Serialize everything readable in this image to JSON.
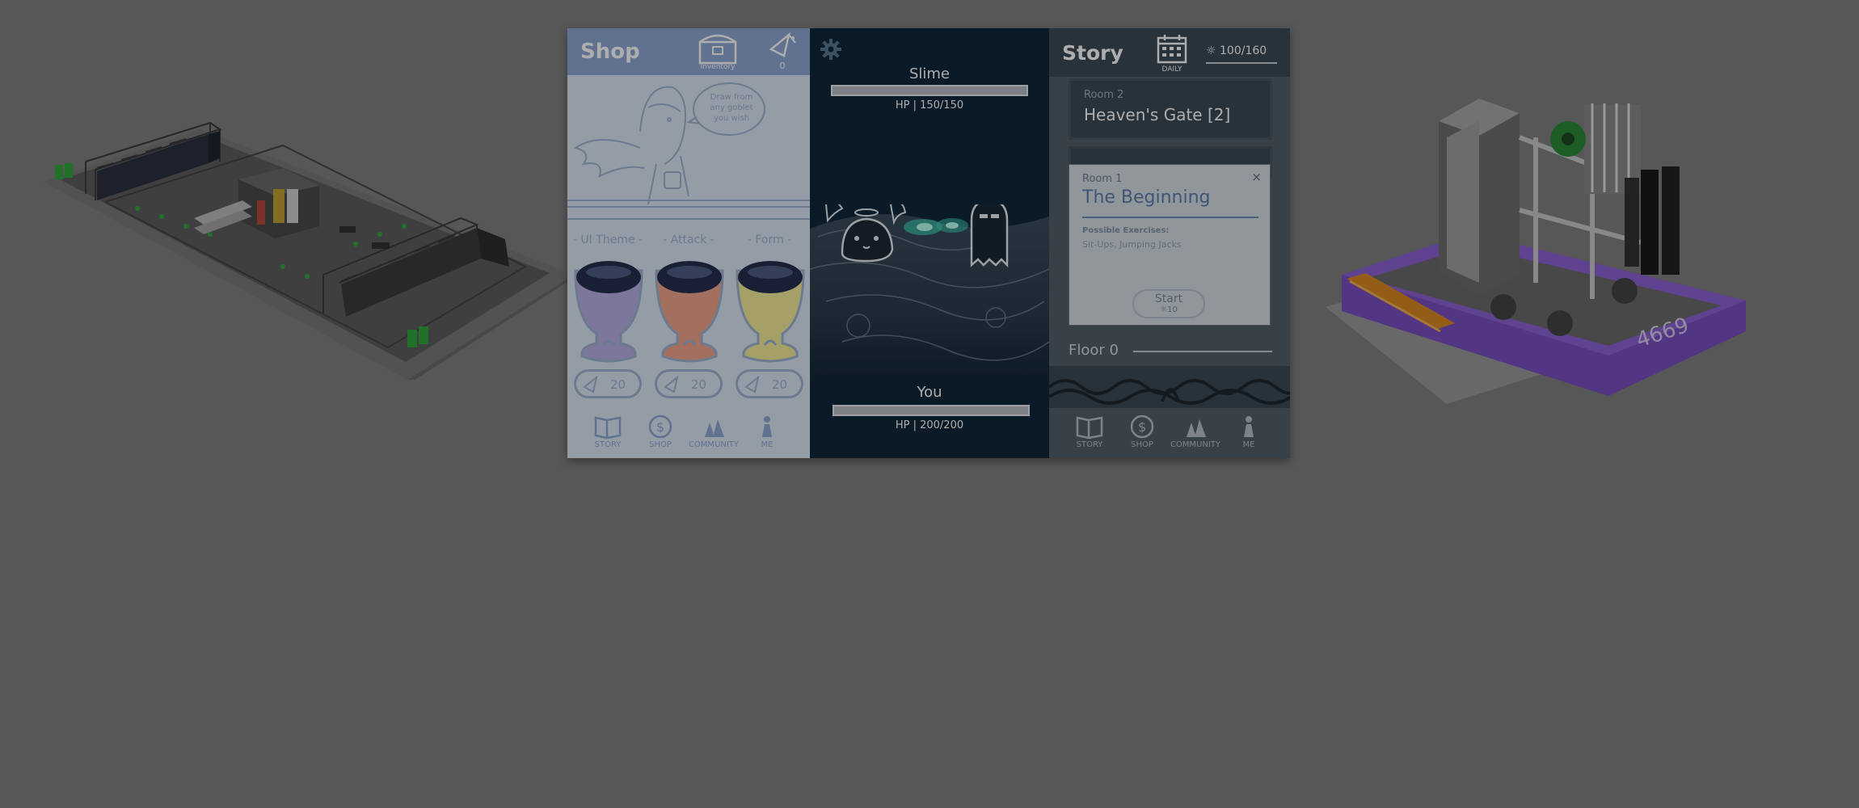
{
  "shop": {
    "title": "Shop",
    "inventory_label": "Inventory",
    "shard_count": "0",
    "speech": [
      "Draw from",
      "any goblet",
      "you wish"
    ],
    "goblets": [
      {
        "label": "- UI Theme -",
        "price": "20",
        "color": "#b8b0e6"
      },
      {
        "label": "- Attack -",
        "price": "20",
        "color": "#f0a58c"
      },
      {
        "label": "- Form -",
        "price": "20",
        "color": "#f2ec9a"
      }
    ],
    "nav": [
      "STORY",
      "SHOP",
      "COMMUNITY",
      "ME"
    ]
  },
  "battle": {
    "enemy": {
      "name": "Slime",
      "hp_text": "HP | 150/150",
      "hp_fraction": 1.0
    },
    "player": {
      "name": "You",
      "hp_text": "HP | 200/200",
      "hp_fraction": 1.0
    }
  },
  "story": {
    "title": "Story",
    "daily_label": "DAILY",
    "energy": "100/160",
    "room_top": {
      "small": "Room 2",
      "title": "Heaven's Gate [2]"
    },
    "modal": {
      "small": "Room 1",
      "title": "The Beginning",
      "close": "×",
      "sub": "Possible Exercises:",
      "text": "Sit-Ups, Jumping Jacks",
      "start_label": "Start",
      "start_cost": "10"
    },
    "floor_label": "Floor 0",
    "nav": [
      "STORY",
      "SHOP",
      "COMMUNITY",
      "ME"
    ]
  },
  "robot": {
    "number": "4669"
  },
  "colors": {
    "background": "#808080",
    "shop_header": "#8fa9d6",
    "battle_bg": "#11273a",
    "story_header": "#3b4b58",
    "robot_purple": "#7a4fc2"
  },
  "icons": [
    "inventory-chest-icon",
    "shard-icon",
    "gear-icon",
    "calendar-icon",
    "sun-icon",
    "book-icon",
    "dollar-icon",
    "community-icon",
    "me-icon"
  ]
}
